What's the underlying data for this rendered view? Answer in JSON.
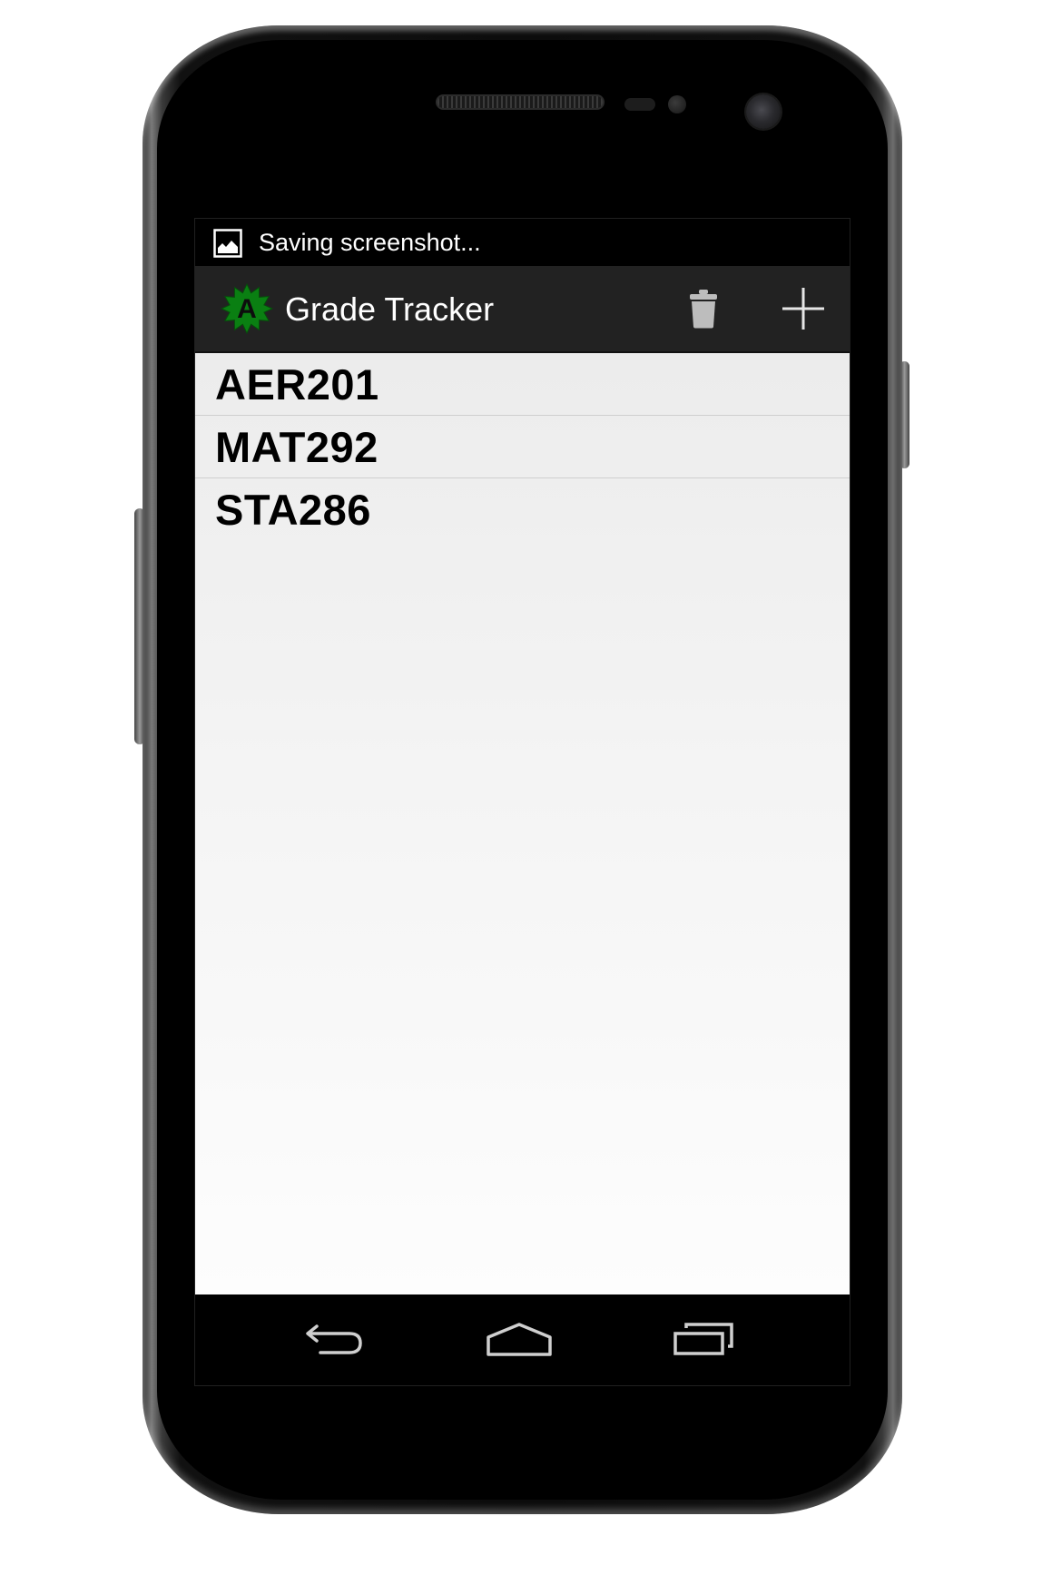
{
  "status_bar": {
    "notification_icon": "image-icon",
    "notification_text": "Saving screenshot..."
  },
  "action_bar": {
    "app_icon": "grade-a-badge-icon",
    "app_icon_letter": "A",
    "title": "Grade Tracker",
    "actions": [
      {
        "icon": "trash-icon"
      },
      {
        "icon": "plus-icon"
      }
    ]
  },
  "courses": [
    {
      "code": "AER201"
    },
    {
      "code": "MAT292"
    },
    {
      "code": "STA286"
    }
  ],
  "nav_bar": {
    "buttons": [
      {
        "icon": "back-icon"
      },
      {
        "icon": "home-icon"
      },
      {
        "icon": "recent-apps-icon"
      }
    ]
  },
  "colors": {
    "action_bar_bg": "#222222",
    "badge_green": "#0a7f12",
    "list_text": "#000000"
  }
}
